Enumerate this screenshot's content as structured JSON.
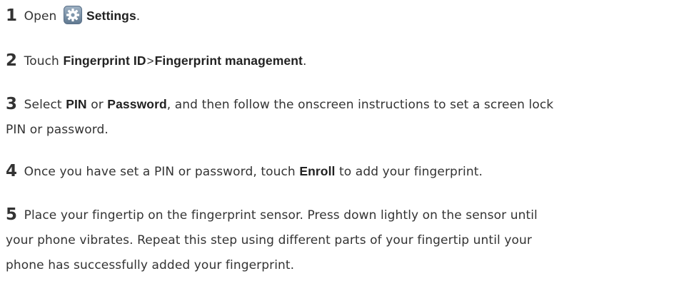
{
  "steps": [
    {
      "number": "1",
      "open": "Open",
      "settings_icon": "gear-icon",
      "settings": "Settings",
      "end": "."
    },
    {
      "number": "2",
      "touch": "Touch",
      "fingerprint_id": "Fingerprint ID",
      "sep": ">",
      "fingerprint_management": "Fingerprint management",
      "end": "."
    },
    {
      "number": "3",
      "select": "Select",
      "pin": "PIN",
      "or": "or",
      "password": "Password",
      "rest_line1": ", and then follow the onscreen instructions to set a screen lock",
      "rest_line2": "PIN or password."
    },
    {
      "number": "4",
      "before": "Once you have set a PIN or password, touch",
      "enroll": "Enroll",
      "after": "to add your fingerprint."
    },
    {
      "number": "5",
      "line1": "Place your fingertip on the fingerprint sensor. Press down lightly on the sensor until",
      "line2": "your phone vibrates. Repeat this step using different parts of your fingertip until your",
      "line3": "phone has successfully added your fingerprint."
    }
  ]
}
